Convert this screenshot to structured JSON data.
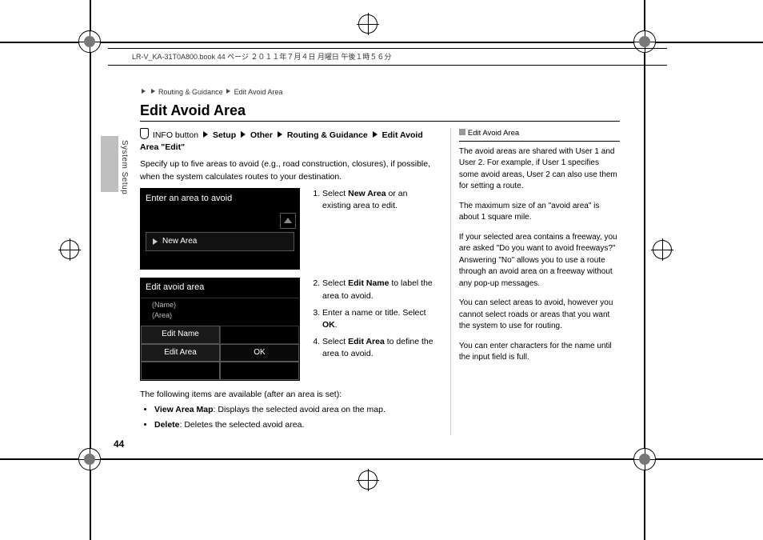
{
  "meta_header": "LR-V_KA-31T0A800.book  44 ページ  ２０１１年７月４日  月曜日  午後１時５６分",
  "side_label": "System Setup",
  "page_number": "44",
  "breadcrumb": {
    "a": "Routing & Guidance",
    "b": "Edit Avoid Area"
  },
  "title": "Edit Avoid Area",
  "navpath": {
    "info": "INFO button",
    "p1": "Setup",
    "p2": "Other",
    "p3": "Routing & Guidance",
    "p4": "Edit Avoid Area",
    "p5": "\"Edit\""
  },
  "intro": "Specify up to five areas to avoid (e.g., road construction, closures), if possible, when the system calculates routes to your destination.",
  "device1": {
    "title": "Enter an area to avoid",
    "row": "New Area"
  },
  "steps1": {
    "s1a": "Select ",
    "s1b": "New Area",
    "s1c": " or an existing area to edit."
  },
  "device2": {
    "title": "Edit avoid area",
    "field1": "(Name)",
    "field2": "(Area)",
    "btn_edit_name": "Edit Name",
    "btn_edit_area": "Edit Area",
    "btn_ok": "OK"
  },
  "steps2": {
    "s2a": "Select ",
    "s2b": "Edit Name",
    "s2c": " to label the area to avoid.",
    "s3a": "Enter a name or title. Select ",
    "s3b": "OK",
    "s3c": ".",
    "s4a": "Select ",
    "s4b": "Edit Area",
    "s4c": " to define the area to avoid."
  },
  "available": {
    "head": "The following items are available (after an area is set):",
    "i1b": "View Area Map",
    "i1t": ": Displays the selected avoid area on the map.",
    "i2b": "Delete",
    "i2t": ": Deletes the selected avoid area."
  },
  "info": {
    "head": "Edit Avoid Area",
    "p1": "The avoid areas are shared with User 1 and User 2. For example, if User 1 specifies some avoid areas, User 2 can also use them for setting a route.",
    "p2": "The maximum size of an \"avoid area\" is about 1 square mile.",
    "p3": "If your selected area contains a freeway, you are asked \"Do you want to avoid freeways?\" Answering \"No\" allows you to use a route through an avoid area on a freeway without any pop-up messages.",
    "p4": "You can select areas to avoid, however you cannot select roads or areas that you want the system to use for routing.",
    "p5": "You can enter characters for the name until the input field is full."
  }
}
